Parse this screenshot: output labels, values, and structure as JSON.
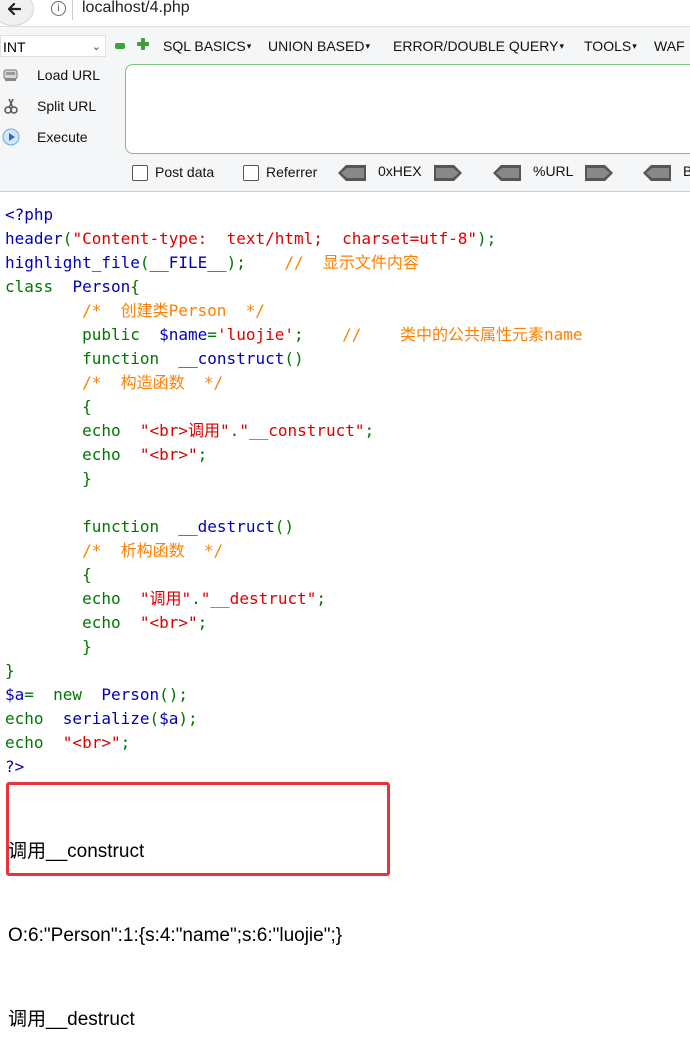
{
  "address_bar": {
    "url": "localhost/4.php",
    "info_glyph": "i"
  },
  "hackbar": {
    "select_value": "INT",
    "menus": [
      "SQL BASICS",
      "UNION BASED",
      "ERROR/DOUBLE QUERY",
      "TOOLS",
      "WAF"
    ],
    "side_buttons": [
      "Load URL",
      "Split URL",
      "Execute"
    ],
    "checkboxes": [
      "Post data",
      "Referrer"
    ],
    "encoders": [
      "0xHEX",
      "%URL",
      "B"
    ],
    "accent_color": "#3aa43a"
  },
  "code_lines": [
    [
      {
        "c": "def",
        "t": "<?php"
      }
    ],
    [
      {
        "c": "def",
        "t": "header"
      },
      {
        "c": "kw",
        "t": "("
      },
      {
        "c": "str",
        "t": "\"Content-type:  text/html;  charset=utf-8\""
      },
      {
        "c": "kw",
        "t": ");"
      }
    ],
    [
      {
        "c": "def",
        "t": "highlight_file"
      },
      {
        "c": "kw",
        "t": "("
      },
      {
        "c": "def",
        "t": "__FILE__"
      },
      {
        "c": "kw",
        "t": ");    "
      },
      {
        "c": "cmt",
        "t": "//  显示文件内容"
      }
    ],
    [
      {
        "c": "kw",
        "t": "class  "
      },
      {
        "c": "def",
        "t": "Person"
      },
      {
        "c": "kw",
        "t": "{"
      }
    ],
    [
      {
        "c": "kw",
        "t": "        "
      },
      {
        "c": "cmt",
        "t": "/*  创建类Person  */"
      }
    ],
    [
      {
        "c": "kw",
        "t": "        public  "
      },
      {
        "c": "def",
        "t": "$name"
      },
      {
        "c": "kw",
        "t": "="
      },
      {
        "c": "str",
        "t": "'luojie'"
      },
      {
        "c": "kw",
        "t": ";    "
      },
      {
        "c": "cmt",
        "t": "//    类中的公共属性元素name"
      }
    ],
    [
      {
        "c": "kw",
        "t": "        function  "
      },
      {
        "c": "def",
        "t": "__construct"
      },
      {
        "c": "kw",
        "t": "()"
      }
    ],
    [
      {
        "c": "kw",
        "t": "        "
      },
      {
        "c": "cmt",
        "t": "/*  构造函数  */"
      }
    ],
    [
      {
        "c": "kw",
        "t": "        {"
      }
    ],
    [
      {
        "c": "kw",
        "t": "        echo  "
      },
      {
        "c": "str",
        "t": "\"<br>调用\""
      },
      {
        "c": "kw",
        "t": "."
      },
      {
        "c": "str",
        "t": "\"__construct\""
      },
      {
        "c": "kw",
        "t": ";"
      }
    ],
    [
      {
        "c": "kw",
        "t": "        echo  "
      },
      {
        "c": "str",
        "t": "\"<br>\""
      },
      {
        "c": "kw",
        "t": ";"
      }
    ],
    [
      {
        "c": "kw",
        "t": "        }"
      }
    ],
    [
      {
        "c": "kw",
        "t": ""
      }
    ],
    [
      {
        "c": "kw",
        "t": "        function  "
      },
      {
        "c": "def",
        "t": "__destruct"
      },
      {
        "c": "kw",
        "t": "()"
      }
    ],
    [
      {
        "c": "kw",
        "t": "        "
      },
      {
        "c": "cmt",
        "t": "/*  析构函数  */"
      }
    ],
    [
      {
        "c": "kw",
        "t": "        {"
      }
    ],
    [
      {
        "c": "kw",
        "t": "        echo  "
      },
      {
        "c": "str",
        "t": "\"调用\""
      },
      {
        "c": "kw",
        "t": "."
      },
      {
        "c": "str",
        "t": "\"__destruct\""
      },
      {
        "c": "kw",
        "t": ";"
      }
    ],
    [
      {
        "c": "kw",
        "t": "        echo  "
      },
      {
        "c": "str",
        "t": "\"<br>\""
      },
      {
        "c": "kw",
        "t": ";"
      }
    ],
    [
      {
        "c": "kw",
        "t": "        }"
      }
    ],
    [
      {
        "c": "kw",
        "t": "}"
      }
    ],
    [
      {
        "c": "def",
        "t": "$a"
      },
      {
        "c": "kw",
        "t": "=  new  "
      },
      {
        "c": "def",
        "t": "Person"
      },
      {
        "c": "kw",
        "t": "();"
      }
    ],
    [
      {
        "c": "kw",
        "t": "echo  "
      },
      {
        "c": "def",
        "t": "serialize"
      },
      {
        "c": "kw",
        "t": "("
      },
      {
        "c": "def",
        "t": "$a"
      },
      {
        "c": "kw",
        "t": ");"
      }
    ],
    [
      {
        "c": "kw",
        "t": "echo  "
      },
      {
        "c": "str",
        "t": "\"<br>\""
      },
      {
        "c": "kw",
        "t": ";"
      }
    ],
    [
      {
        "c": "def",
        "t": "?>"
      }
    ]
  ],
  "output_lines": [
    "调用__construct",
    "O:6:\"Person\":1:{s:4:\"name\";s:6:\"luojie\";}",
    "调用__destruct"
  ],
  "highlight_color": "#e8323c"
}
